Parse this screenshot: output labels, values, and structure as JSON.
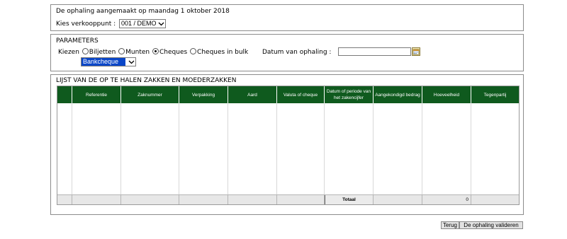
{
  "header": {
    "created_text": "De ophaling aangemaakt op maandag 1 oktober 2018",
    "sales_point_label": "Kies verkooppunt :",
    "sales_point_value": "001 / DEMO"
  },
  "parameters": {
    "title": "PARAMETERS",
    "choose_label": "Kiezen",
    "options": [
      {
        "label": "Biljetten",
        "selected": false
      },
      {
        "label": "Munten",
        "selected": false
      },
      {
        "label": "Cheques",
        "selected": true
      },
      {
        "label": "Cheques in bulk",
        "selected": false
      }
    ],
    "date_label": "Datum van ophaling :",
    "date_value": "",
    "cheque_type": "Bankcheque"
  },
  "list": {
    "title": "LIJST VAN DE OP TE HALEN ZAKKEN EN MOEDERZAKKEN",
    "columns": [
      "",
      "Referentie",
      "Zaknummer",
      "Verpakking",
      "Aard",
      "Valuta of cheque",
      "Datum of periode van het zakencijfer",
      "Aangekondigd bedrag",
      "Hoeveelheid",
      "Tegenpartij"
    ],
    "footer": {
      "total_label": "Totaal",
      "total_value": "0"
    }
  },
  "buttons": {
    "back": "Terug",
    "validate": "De ophaling valideren"
  },
  "colors": {
    "header_bg": "#0f5a1e",
    "selected_option_bg": "#0a46c8"
  }
}
